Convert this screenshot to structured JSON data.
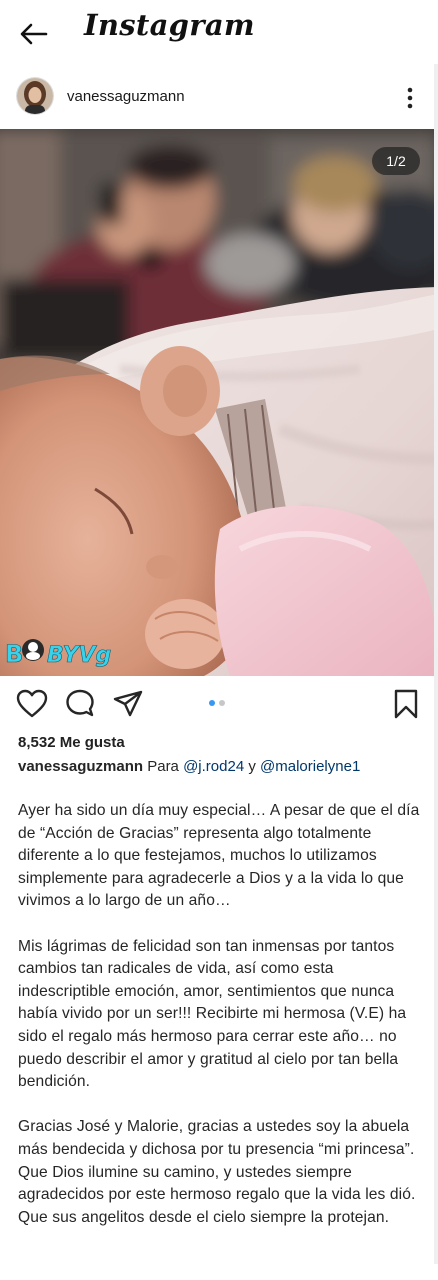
{
  "header": {
    "back_icon": "arrow-left-icon",
    "logo_text": "Instagram"
  },
  "post": {
    "username": "vanessaguzmann",
    "more_icon": "more-vertical-icon",
    "image_counter": "1/2",
    "watermark": "BABYVg",
    "actions": {
      "like_icon": "heart-icon",
      "comment_icon": "comment-icon",
      "share_icon": "send-icon",
      "save_icon": "bookmark-icon"
    },
    "carousel_index": 1,
    "carousel_total": 2,
    "likes_text": "8,532 Me gusta",
    "caption_username": "vanessaguzmann",
    "caption_intro": "Para",
    "mention1": "@j.rod24",
    "caption_and": "y",
    "mention2": "@malorielyne1",
    "paragraphs": [
      "Ayer ha sido un día muy especial… A pesar de que el día de “Acción de Gracias” representa algo totalmente diferente  a lo que festejamos, muchos lo utilizamos simplemente para agradecerle a Dios y a la vida lo que vivimos a lo largo de un año…",
      "Mis lágrimas de felicidad son tan inmensas por tantos cambios tan radicales de vida, así como esta indescriptible emoción, amor, sentimientos que nunca había vivido por un ser!!! Recibirte mi hermosa (V.E) ha sido el regalo más hermoso para cerrar este año… no puedo describir el amor y gratitud al cielo por tan bella bendición.",
      "Gracias José y Malorie, gracias a ustedes soy la abuela más bendecida y dichosa por tu presencia “mi princesa”.",
      "Que Dios ilumine su camino, y ustedes siempre agradecidos por este hermoso regalo que la vida les dió. Que sus angelitos desde el cielo siempre la protejan."
    ]
  },
  "colors": {
    "mention": "#00376b",
    "carousel_active_dot": "#3897f0",
    "text": "#262626"
  }
}
